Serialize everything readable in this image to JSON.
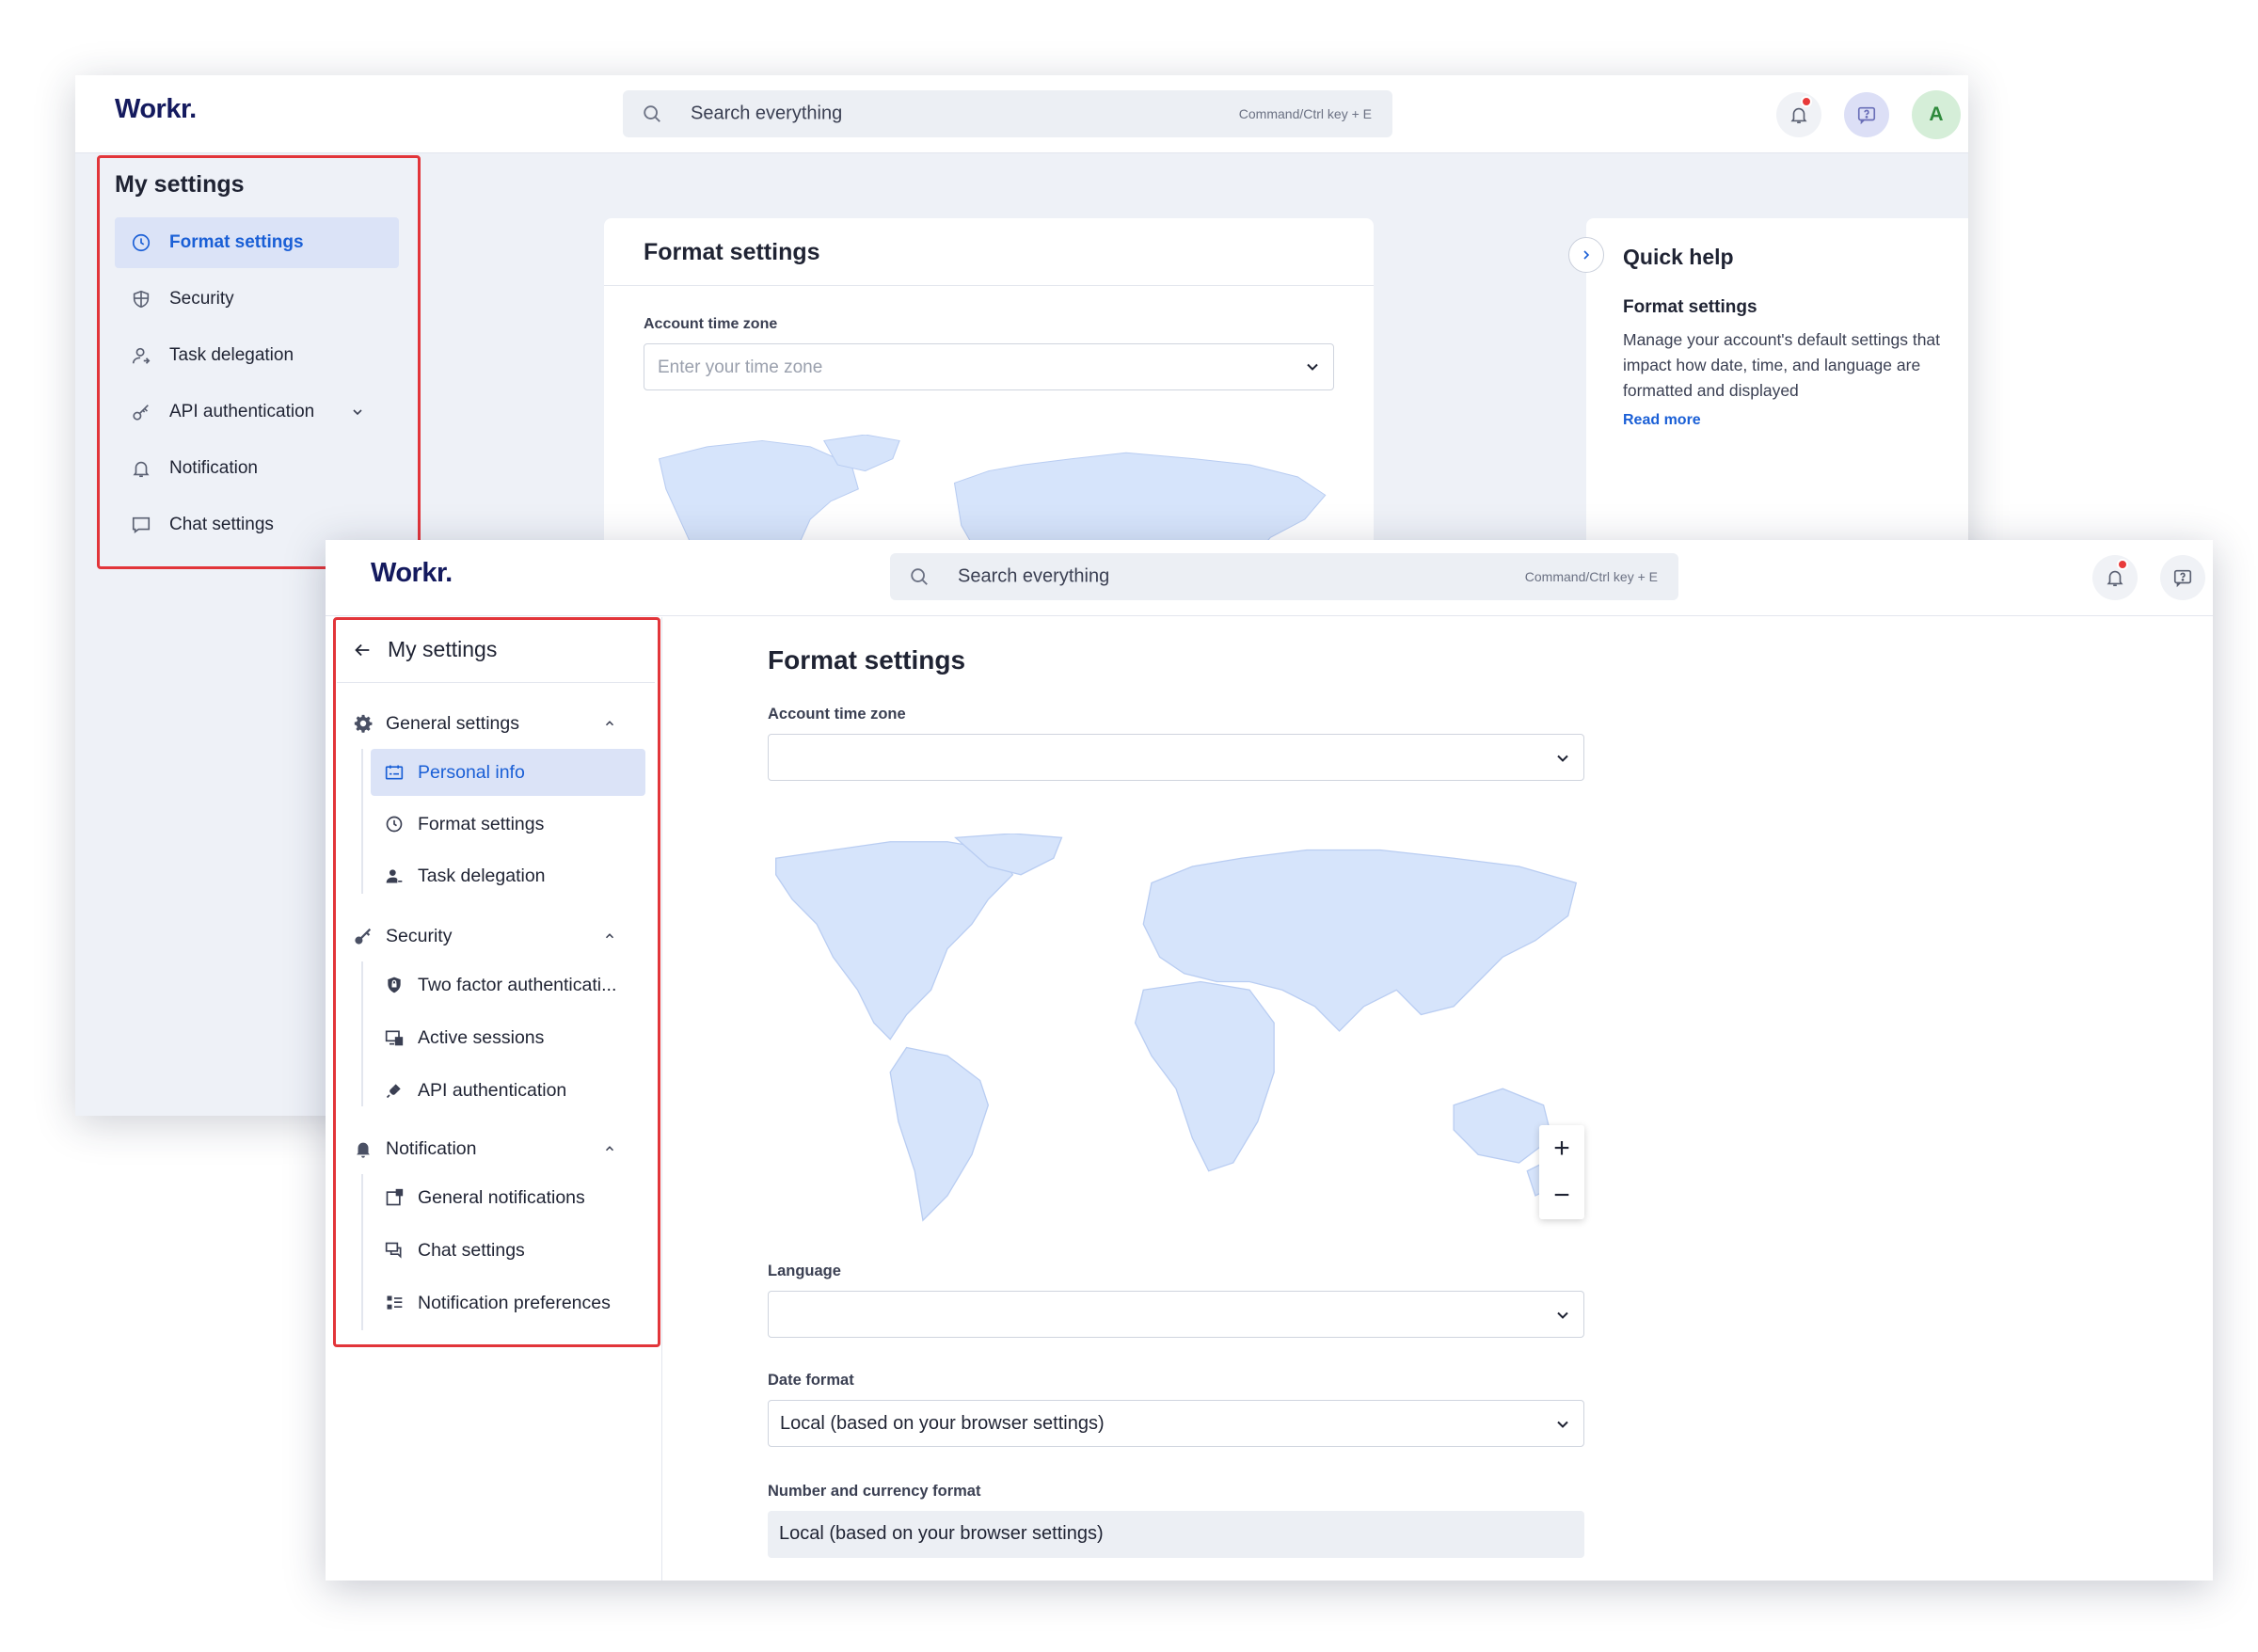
{
  "back_window": {
    "brand": "Workr.",
    "search": {
      "placeholder": "Search everything",
      "hint": "Command/Ctrl key + E"
    },
    "avatar_initial": "A",
    "sidebar": {
      "title": "My settings",
      "items": [
        {
          "label": "Format settings",
          "icon": "clock-icon",
          "active": true
        },
        {
          "label": "Security",
          "icon": "shield-icon"
        },
        {
          "label": "Task delegation",
          "icon": "user-icon"
        },
        {
          "label": "API authentication",
          "icon": "key-icon",
          "expandable": true
        },
        {
          "label": "Notification",
          "icon": "bell-icon"
        },
        {
          "label": "Chat settings",
          "icon": "chat-icon"
        }
      ]
    },
    "card": {
      "title": "Format settings",
      "timezone_label": "Account time zone",
      "timezone_placeholder": "Enter your time zone"
    },
    "quick_help": {
      "title": "Quick help",
      "subtitle": "Format settings",
      "body": "Manage your account's default settings that impact how date, time, and language are formatted and displayed",
      "link": "Read more"
    }
  },
  "front_window": {
    "brand": "Workr.",
    "search": {
      "placeholder": "Search everything",
      "hint": "Command/Ctrl key + E"
    },
    "sidebar": {
      "title": "My settings",
      "groups": [
        {
          "label": "General settings",
          "icon": "gear-icon",
          "items": [
            {
              "label": "Personal info",
              "icon": "id-card-icon",
              "active": true
            },
            {
              "label": "Format settings",
              "icon": "clock-icon"
            },
            {
              "label": "Task delegation",
              "icon": "user-icon"
            }
          ]
        },
        {
          "label": "Security",
          "icon": "key-icon",
          "items": [
            {
              "label": "Two factor authenticati...",
              "icon": "lock-shield-icon"
            },
            {
              "label": "Active sessions",
              "icon": "sessions-icon"
            },
            {
              "label": "API authentication",
              "icon": "plug-icon"
            }
          ]
        },
        {
          "label": "Notification",
          "icon": "bell-icon",
          "items": [
            {
              "label": "General notifications",
              "icon": "notification-window-icon"
            },
            {
              "label": "Chat settings",
              "icon": "chat-icon"
            },
            {
              "label": "Notification preferences",
              "icon": "sliders-icon"
            }
          ]
        }
      ]
    },
    "main": {
      "title": "Format settings",
      "timezone_label": "Account time zone",
      "timezone_value": "",
      "language_label": "Language",
      "language_value": "",
      "date_format_label": "Date format",
      "date_format_value": "Local (based on your browser settings)",
      "number_format_label": "Number and currency format",
      "number_format_value": "Local (based on your browser settings)",
      "zoom_in": "+",
      "zoom_out": "−"
    }
  },
  "colors": {
    "accent": "#1a5fd6",
    "highlight_box": "#e2353a",
    "brand": "#141a5e",
    "map_fill": "#d6e4fb",
    "active_bg": "#dbe3f7"
  }
}
